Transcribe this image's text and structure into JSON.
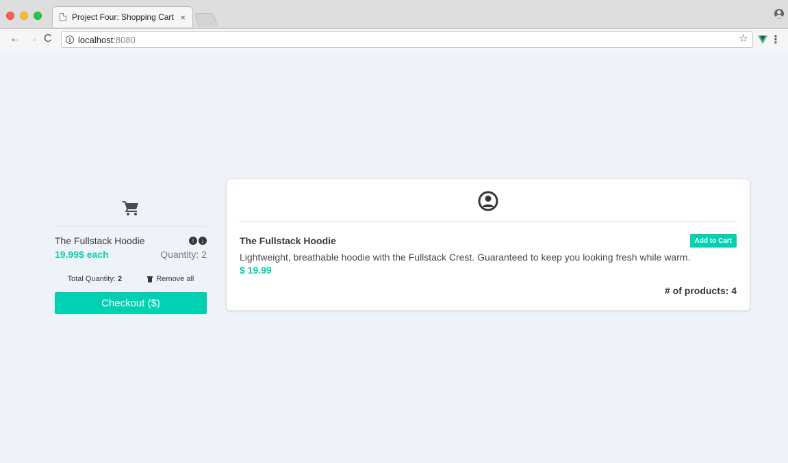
{
  "browser": {
    "tab_title": "Project Four: Shopping Cart",
    "tab_close": "×",
    "url_host": "localhost",
    "url_port": ":8080"
  },
  "colors": {
    "accent": "#00d1b2",
    "background": "#eef2f9",
    "text_dark": "#363636"
  },
  "cart": {
    "icon": "shopping-cart-icon",
    "item": {
      "name": "The Fullstack Hoodie",
      "price_each": "19.99$ each",
      "quantity_text": "Quantity: 2",
      "increase_icon": "arrow-circle-up-icon",
      "decrease_icon": "arrow-circle-down-icon"
    },
    "total_label": "Total Quantity: ",
    "total_value": "2",
    "remove_all_label": "Remove all",
    "remove_icon": "trash-icon",
    "checkout_label": "Checkout ($)"
  },
  "product": {
    "icon": "user-circle-icon",
    "name": "The Fullstack Hoodie",
    "add_to_cart_label": "Add to Cart",
    "description": "Lightweight, breathable hoodie with the Fullstack Crest. Guaranteed to keep you looking fresh while warm.",
    "price": "$ 19.99",
    "count_label": "# of products: 4"
  }
}
